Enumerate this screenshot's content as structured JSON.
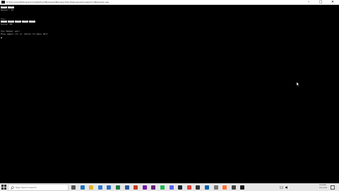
{
  "window": {
    "title": "D:\\Documents\\Programming\\Python\\Blackjack\\Blackjack\\bin\\Debug\\netcoreapp3.1\\Blackjack.exe",
    "buttons": [
      "–",
      "□",
      "✕"
    ]
  },
  "console": {
    "dealer_cards": [
      "8 ♠",
      "7 ♥"
    ],
    "dealer_total": "Dealer: 15",
    "player_heading": "You:",
    "player_cards": [
      "2 ♣",
      "4 ♦",
      "5 ♠",
      "6 ♥",
      "3 ♣"
    ],
    "player_total": "Score: 20",
    "result_line": "You dealer won!",
    "prompt_line": "Play again (Y) or return to menu (N)?"
  },
  "taskbar": {
    "search_placeholder": "Type here to search",
    "icons": [
      "task-view-icon",
      "edge-icon",
      "file-explorer-icon",
      "store-icon",
      "mail-icon",
      "excel-icon",
      "word-icon",
      "powerpoint-icon",
      "onenote-icon",
      "visual-studio-icon",
      "spotify-icon",
      "discord-icon",
      "steam-icon",
      "chrome-icon",
      "terminal-icon",
      "photos-icon",
      "settings-icon",
      "firefox-icon",
      "calculator-icon",
      "console-icon"
    ],
    "icon_colors": [
      "#555555",
      "#1e73be",
      "#e6b325",
      "#2a7bd4",
      "#2b6cc4",
      "#1f7a44",
      "#2b579a",
      "#c43e1c",
      "#7719aa",
      "#68217a",
      "#1db954",
      "#5865f2",
      "#1b2838",
      "#db4437",
      "#333333",
      "#0063b1",
      "#767676",
      "#ff7139",
      "#444444",
      "#1a1a1a"
    ],
    "time": "09:42 AM",
    "date": "02/12/2021"
  }
}
